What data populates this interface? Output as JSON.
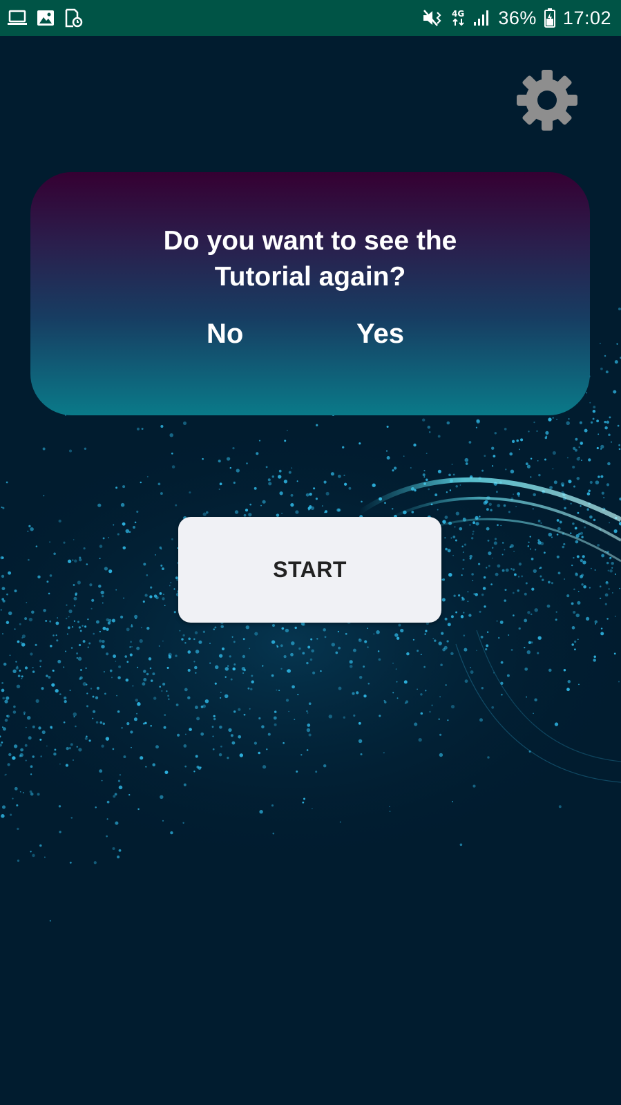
{
  "status_bar": {
    "battery": "36%",
    "time": "17:02",
    "network": "4G",
    "left_icons": [
      "laptop-icon",
      "image-icon",
      "file-clock-icon"
    ],
    "right_icons": [
      "mute-vibrate-icon",
      "network-4g-icon",
      "signal-icon",
      "battery-charging-icon"
    ]
  },
  "settings": {
    "icon": "gear-icon"
  },
  "dialog": {
    "question_line1": "Do you want to see the",
    "question_line2": "Tutorial again?",
    "no_label": "No",
    "yes_label": "Yes"
  },
  "start": {
    "label": "START"
  },
  "colors": {
    "status_bar": "#005446",
    "background": "#011c2f",
    "dialog_top": "#350032",
    "dialog_bottom": "#0a7a89",
    "start_button": "#f0f1f5",
    "gear": "#8e8e8e",
    "particles": "#2fb8e6"
  }
}
